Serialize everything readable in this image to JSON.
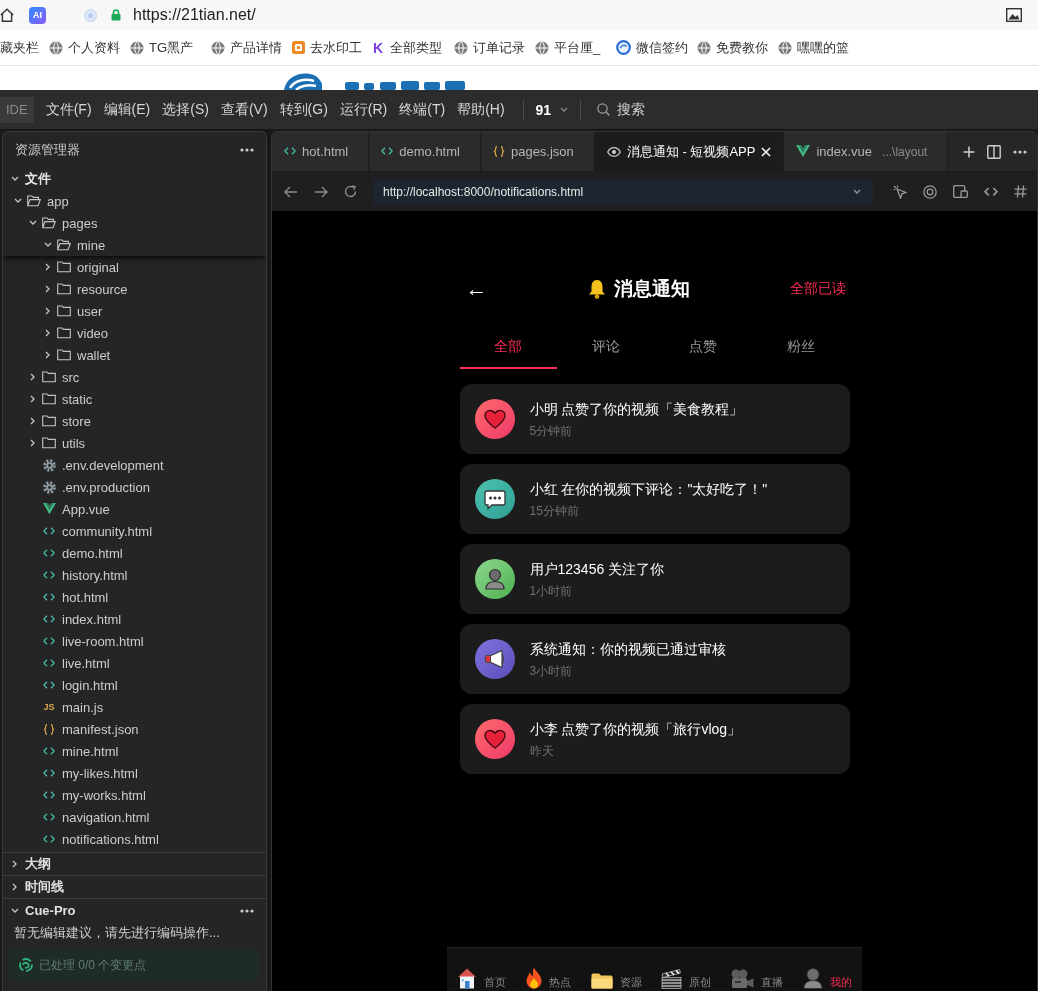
{
  "browser": {
    "app_label": "AI",
    "url": "https://21tian.net/",
    "bookmarks": [
      {
        "label": "藏夹栏",
        "kind": "plain"
      },
      {
        "label": "个人资料",
        "kind": "globe"
      },
      {
        "label": "TG黑产",
        "kind": "globe"
      },
      {
        "label": "产品详情",
        "kind": "globe"
      },
      {
        "label": "去水印工",
        "kind": "tile"
      },
      {
        "label": "全部类型",
        "kind": "letter",
        "glyph": "K"
      },
      {
        "label": "订单记录",
        "kind": "globe"
      },
      {
        "label": "平台厘_",
        "kind": "globe"
      },
      {
        "label": "微信签约",
        "kind": "ring"
      },
      {
        "label": "免费教你",
        "kind": "globe"
      },
      {
        "label": "嘿嘿的篮",
        "kind": "globe"
      }
    ]
  },
  "menubar": {
    "product": "IDE",
    "items": [
      "文件(F)",
      "编辑(E)",
      "选择(S)",
      "查看(V)",
      "转到(G)",
      "运行(R)",
      "终端(T)",
      "帮助(H)"
    ],
    "counter": "91",
    "search": "搜索"
  },
  "explorer": {
    "title": "资源管理器",
    "tree": [
      {
        "label": "文件",
        "kind": "section",
        "expanded": true,
        "children": [
          {
            "label": "app",
            "kind": "folder",
            "expanded": true,
            "children": [
              {
                "label": "pages",
                "kind": "folder",
                "expanded": true,
                "children": [
                  {
                    "label": "mine",
                    "kind": "folder",
                    "expanded": true
                  },
                  {
                    "label": "original",
                    "kind": "folder",
                    "expanded": false
                  },
                  {
                    "label": "resource",
                    "kind": "folder",
                    "expanded": false
                  },
                  {
                    "label": "user",
                    "kind": "folder",
                    "expanded": false
                  },
                  {
                    "label": "video",
                    "kind": "folder",
                    "expanded": false
                  },
                  {
                    "label": "wallet",
                    "kind": "folder",
                    "expanded": false
                  }
                ]
              },
              {
                "label": "src",
                "kind": "folder",
                "expanded": false
              },
              {
                "label": "static",
                "kind": "folder",
                "expanded": false
              },
              {
                "label": "store",
                "kind": "folder",
                "expanded": false
              },
              {
                "label": "utils",
                "kind": "folder",
                "expanded": false
              },
              {
                "label": ".env.development",
                "kind": "config"
              },
              {
                "label": ".env.production",
                "kind": "config"
              },
              {
                "label": "App.vue",
                "kind": "vue"
              },
              {
                "label": "community.html",
                "kind": "html"
              },
              {
                "label": "demo.html",
                "kind": "html"
              },
              {
                "label": "history.html",
                "kind": "html"
              },
              {
                "label": "hot.html",
                "kind": "html"
              },
              {
                "label": "index.html",
                "kind": "html"
              },
              {
                "label": "live-room.html",
                "kind": "html"
              },
              {
                "label": "live.html",
                "kind": "html"
              },
              {
                "label": "login.html",
                "kind": "html"
              },
              {
                "label": "main.js",
                "kind": "js",
                "glyph": "JS"
              },
              {
                "label": "manifest.json",
                "kind": "json"
              },
              {
                "label": "mine.html",
                "kind": "html"
              },
              {
                "label": "my-likes.html",
                "kind": "html"
              },
              {
                "label": "my-works.html",
                "kind": "html"
              },
              {
                "label": "navigation.html",
                "kind": "html"
              },
              {
                "label": "notifications.html",
                "kind": "html"
              }
            ]
          }
        ]
      }
    ]
  },
  "panels": [
    {
      "title": "大纲",
      "expanded": false
    },
    {
      "title": "时间线",
      "expanded": false
    }
  ],
  "cue_pro": {
    "title": "Cue-Pro",
    "expanded": true,
    "message": "暂无编辑建议，请先进行编码操作...",
    "status": "已处理 0/0 个变更点"
  },
  "editor_tabs": [
    {
      "label": "hot.html",
      "kind": "html",
      "selected": false
    },
    {
      "label": "demo.html",
      "kind": "html",
      "selected": false
    },
    {
      "label": "pages.json",
      "kind": "json",
      "selected": false
    },
    {
      "label": "消息通知 - 短视频APP",
      "kind": "preview",
      "selected": true
    },
    {
      "label": "index.vue",
      "kind": "vue",
      "selected": false,
      "path": "...\\layout"
    }
  ],
  "preview_toolbar": {
    "url": "http://localhost:8000/notifications.html"
  },
  "app": {
    "back": "←",
    "title": "消息通知",
    "mark_all": "全部已读",
    "tabs": [
      {
        "label": "全部",
        "selected": true
      },
      {
        "label": "评论",
        "selected": false
      },
      {
        "label": "点赞",
        "selected": false
      },
      {
        "label": "粉丝",
        "selected": false
      }
    ],
    "notifications": [
      {
        "kind": "like",
        "text": "小明 点赞了你的视频「美食教程」",
        "time": "5分钟前"
      },
      {
        "kind": "comment",
        "text": "小红 在你的视频下评论：\"太好吃了！\"",
        "time": "15分钟前"
      },
      {
        "kind": "follow",
        "text": "用户123456 关注了你",
        "time": "1小时前"
      },
      {
        "kind": "system",
        "text": "系统通知：你的视频已通过审核",
        "time": "3小时前"
      },
      {
        "kind": "like",
        "text": "小李 点赞了你的视频「旅行vlog」",
        "time": "昨天"
      }
    ],
    "nav": [
      {
        "label": "首页",
        "kind": "home",
        "selected": false
      },
      {
        "label": "热点",
        "kind": "hot",
        "selected": false
      },
      {
        "label": "资源",
        "kind": "resource",
        "selected": false
      },
      {
        "label": "原创",
        "kind": "original",
        "selected": false
      },
      {
        "label": "直播",
        "kind": "live",
        "selected": false
      },
      {
        "label": "我的",
        "kind": "mine",
        "selected": true
      }
    ]
  }
}
